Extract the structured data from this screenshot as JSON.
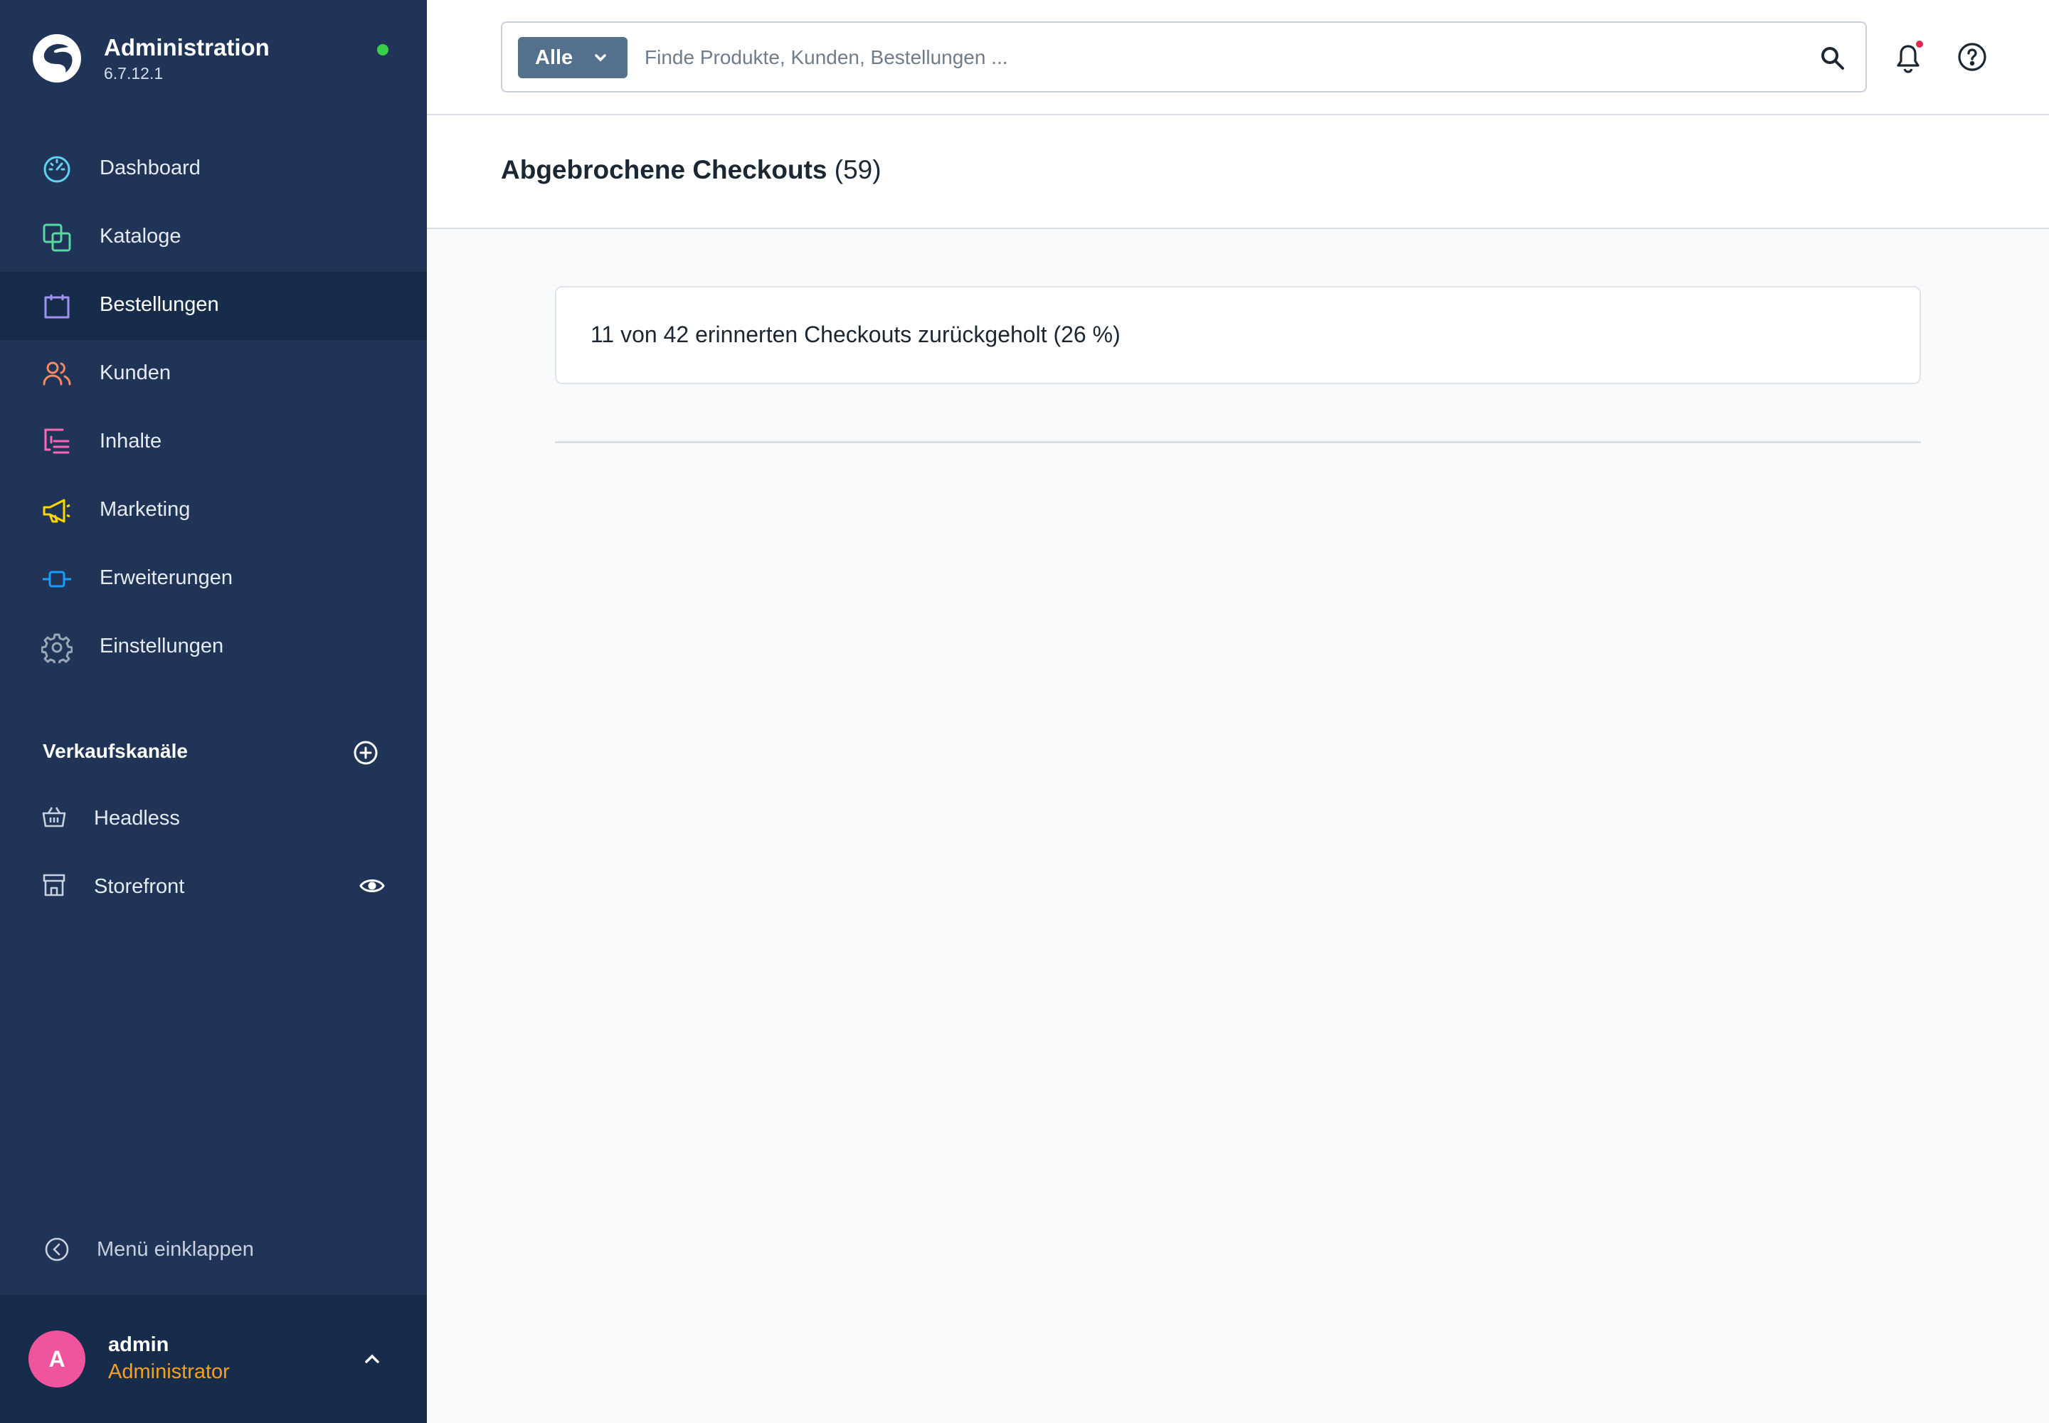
{
  "brand": {
    "title": "Administration",
    "version": "6.7.12.1",
    "status_color": "#37d046"
  },
  "nav": {
    "items": [
      {
        "label": "Dashboard",
        "icon": "dashboard-gauge-icon",
        "color": "#5fd3f3",
        "active": false
      },
      {
        "label": "Kataloge",
        "icon": "catalog-squares-icon",
        "color": "#57d9a3",
        "active": false
      },
      {
        "label": "Bestellungen",
        "icon": "shopping-bag-icon",
        "color": "#a092f0",
        "active": true
      },
      {
        "label": "Kunden",
        "icon": "users-icon",
        "color": "#f88962",
        "active": false
      },
      {
        "label": "Inhalte",
        "icon": "content-list-icon",
        "color": "#ff68b4",
        "active": false
      },
      {
        "label": "Marketing",
        "icon": "megaphone-icon",
        "color": "#ffd700",
        "active": false
      },
      {
        "label": "Erweiterungen",
        "icon": "plug-icon",
        "color": "#189eff",
        "active": false
      },
      {
        "label": "Einstellungen",
        "icon": "gear-icon",
        "color": "#9aa8b5",
        "active": false
      }
    ]
  },
  "channels": {
    "title": "Verkaufskanäle",
    "items": [
      {
        "label": "Headless",
        "icon": "basket-icon"
      },
      {
        "label": "Storefront",
        "icon": "storefront-icon"
      }
    ]
  },
  "collapse_label": "Menü einklappen",
  "user": {
    "initial": "A",
    "name": "admin",
    "role": "Administrator",
    "avatar_color": "#f0549d",
    "role_color": "#f7a01e"
  },
  "search": {
    "type_label": "Alle",
    "placeholder": "Finde Produkte, Kunden, Bestellungen ...",
    "value": ""
  },
  "page": {
    "title": "Abgebrochene Checkouts",
    "count": "(59)"
  },
  "info": {
    "text": "11 von 42 erinnerten Checkouts zurückgeholt (26 %)"
  },
  "colors": {
    "sidebar": "#1f3456",
    "sidebar_active": "#172b4a",
    "accent_dropdown": "#53708c",
    "notification_dot": "#de294c"
  }
}
